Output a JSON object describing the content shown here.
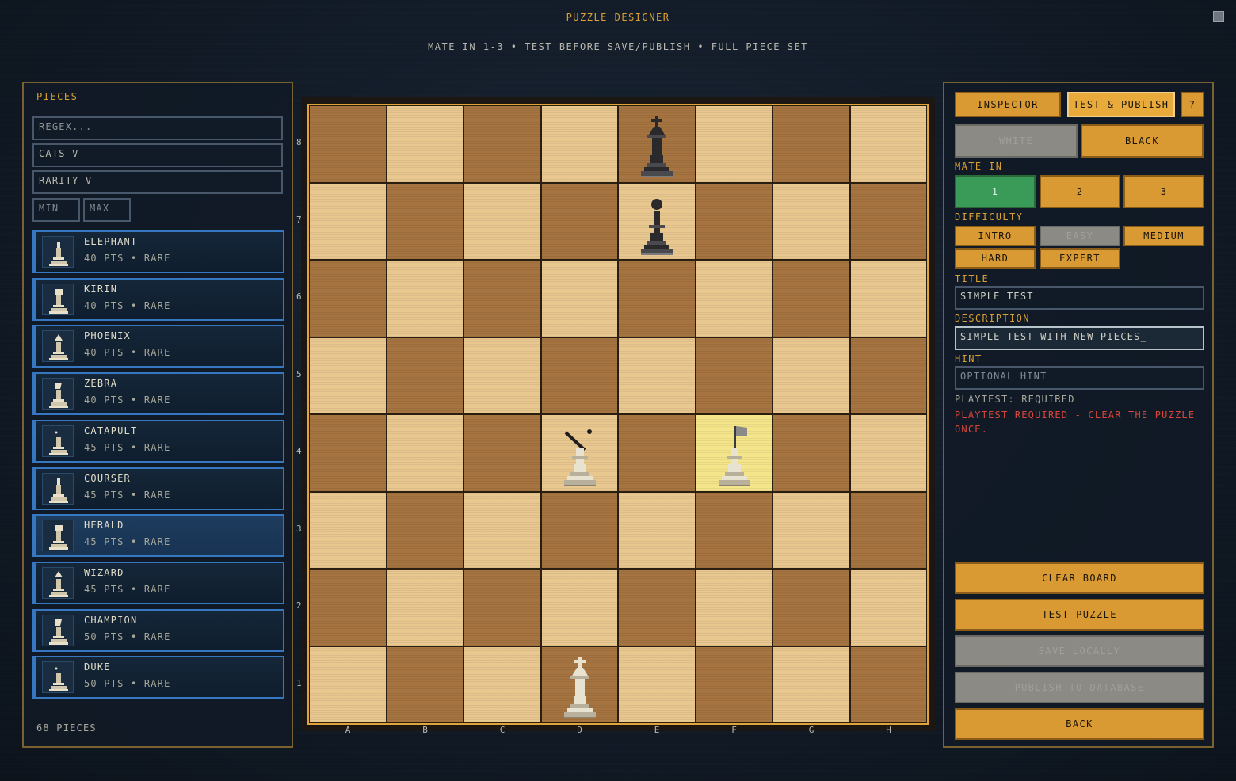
{
  "app": {
    "title": "PUZZLE DESIGNER",
    "subtitle": "MATE IN 1-3 • TEST BEFORE SAVE/PUBLISH • FULL PIECE SET"
  },
  "pieces_panel": {
    "heading": "PIECES",
    "search_placeholder": "REGEX...",
    "category_filter": "CATS V",
    "rarity_filter": "RARITY V",
    "min_placeholder": "MIN",
    "max_placeholder": "MAX",
    "items": [
      {
        "name": "ELEPHANT",
        "meta": "40 PTS • RARE"
      },
      {
        "name": "KIRIN",
        "meta": "40 PTS • RARE"
      },
      {
        "name": "PHOENIX",
        "meta": "40 PTS • RARE"
      },
      {
        "name": "ZEBRA",
        "meta": "40 PTS • RARE"
      },
      {
        "name": "CATAPULT",
        "meta": "45 PTS • RARE"
      },
      {
        "name": "COURSER",
        "meta": "45 PTS • RARE"
      },
      {
        "name": "HERALD",
        "meta": "45 PTS • RARE"
      },
      {
        "name": "WIZARD",
        "meta": "45 PTS • RARE"
      },
      {
        "name": "CHAMPION",
        "meta": "50 PTS • RARE"
      },
      {
        "name": "DUKE",
        "meta": "50 PTS • RARE"
      }
    ],
    "count_label": "68 PIECES"
  },
  "board": {
    "files": [
      "A",
      "B",
      "C",
      "D",
      "E",
      "F",
      "G",
      "H"
    ],
    "ranks": [
      "8",
      "7",
      "6",
      "5",
      "4",
      "3",
      "2",
      "1"
    ],
    "highlight_square": "F4",
    "pieces": [
      {
        "square": "E8",
        "piece": "king",
        "color": "black"
      },
      {
        "square": "E7",
        "piece": "pawn",
        "color": "black"
      },
      {
        "square": "D4",
        "piece": "catapult",
        "color": "white"
      },
      {
        "square": "F4",
        "piece": "herald",
        "color": "white"
      },
      {
        "square": "D1",
        "piece": "king",
        "color": "white"
      }
    ]
  },
  "right_panel": {
    "tabs": {
      "inspector": "INSPECTOR",
      "test_publish": "TEST & PUBLISH",
      "help": "?"
    },
    "side": {
      "white": "WHITE",
      "black": "BLACK"
    },
    "mate_in_label": "MATE IN",
    "mate_options": [
      "1",
      "2",
      "3"
    ],
    "difficulty_label": "DIFFICULTY",
    "difficulty_options": [
      "INTRO",
      "EASY",
      "MEDIUM",
      "HARD",
      "EXPERT"
    ],
    "title_label": "TITLE",
    "title_value": "SIMPLE TEST",
    "description_label": "DESCRIPTION",
    "description_value": "SIMPLE TEST WITH NEW PIECES_",
    "hint_label": "HINT",
    "hint_placeholder": "OPTIONAL HINT",
    "playtest_status": "PLAYTEST: REQUIRED",
    "playtest_warning": "PLAYTEST REQUIRED - CLEAR THE PUZZLE ONCE.",
    "actions": {
      "clear_board": "CLEAR BOARD",
      "test_puzzle": "TEST PUZZLE",
      "save_locally": "SAVE LOCALLY",
      "publish": "PUBLISH TO DATABASE",
      "back": "BACK"
    }
  },
  "colors": {
    "accent": "#d99a33",
    "selected_green": "#3a9a58",
    "card_border": "#3677c2",
    "warning": "#d8463a",
    "highlight": "#f4e58a",
    "light_square": "#e9c890",
    "dark_square": "#a67440"
  }
}
